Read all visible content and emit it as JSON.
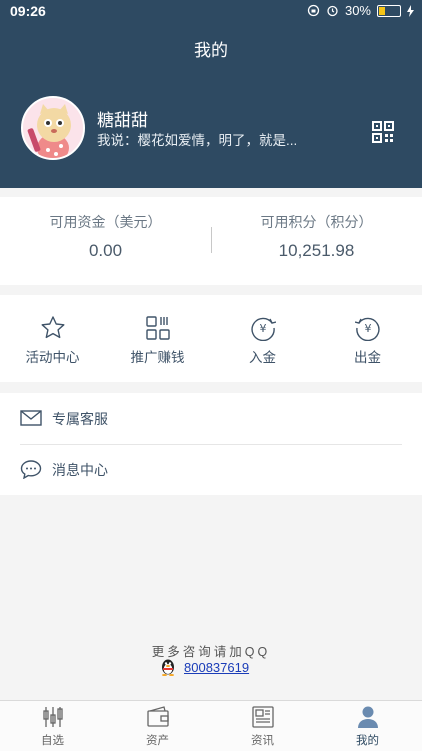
{
  "status_bar": {
    "time": "09:26",
    "battery": "30%",
    "battery_level": 0.3
  },
  "header": {
    "title": "我的",
    "username": "糖甜甜",
    "signature": "我说：樱花如爱情，明了，就是..."
  },
  "funds": {
    "available_label": "可用资金（美元）",
    "available_value": "0.00",
    "points_label": "可用积分（积分）",
    "points_value": "10,251.98"
  },
  "actions": [
    {
      "label": "活动中心",
      "icon": "star-icon"
    },
    {
      "label": "推广赚钱",
      "icon": "qr-promo-icon"
    },
    {
      "label": "入金",
      "icon": "deposit-yen-icon"
    },
    {
      "label": "出金",
      "icon": "withdraw-yen-icon"
    }
  ],
  "menu": [
    {
      "label": "专属客服",
      "icon": "mail-icon"
    },
    {
      "label": "消息中心",
      "icon": "chat-bubble-icon"
    }
  ],
  "footer": {
    "note": "更多咨询请加QQ",
    "qq_number": "800837619"
  },
  "tabbar": [
    {
      "label": "自选",
      "icon": "candlestick-icon"
    },
    {
      "label": "资产",
      "icon": "wallet-icon"
    },
    {
      "label": "资讯",
      "icon": "news-icon"
    },
    {
      "label": "我的",
      "icon": "person-icon",
      "active": true
    }
  ],
  "colors": {
    "primary": "#2e4a62",
    "link": "#1a3cb8",
    "background": "#f4f4f4"
  }
}
